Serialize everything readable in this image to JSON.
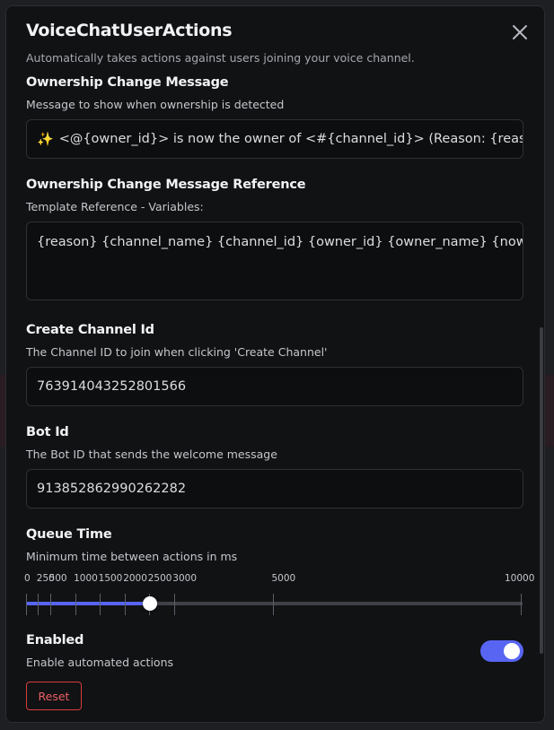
{
  "modal": {
    "title": "VoiceChatUserActions",
    "subtitle": "Automatically takes actions against users joining your voice channel."
  },
  "icons": {
    "close": "close-icon",
    "sparkle": "sparkles-icon"
  },
  "fields": {
    "ownership_message": {
      "label": "Ownership Change Message",
      "description": "Message to show when ownership is detected",
      "emoji": "✨",
      "value": "<@{owner_id}> is now the owner of <#{channel_id}> (Reason: {reason})"
    },
    "ownership_reference": {
      "label": "Ownership Change Message Reference",
      "description": "Template Reference - Variables:",
      "value": "{reason} {channel_name} {channel_id} {owner_id} {owner_name} {now}"
    },
    "create_channel_id": {
      "label": "Create Channel Id",
      "description": "The Channel ID to join when clicking 'Create Channel'",
      "value": "763914043252801566"
    },
    "bot_id": {
      "label": "Bot Id",
      "description": "The Bot ID that sends the welcome message",
      "value": "913852862990262282"
    },
    "queue_time": {
      "label": "Queue Time",
      "description": "Minimum time between actions in ms",
      "markers": [
        "0",
        "250",
        "500",
        "1000",
        "1500",
        "2000",
        "2500",
        "3000",
        "5000",
        "10000"
      ],
      "value": 2500
    },
    "enabled": {
      "label": "Enabled",
      "description": "Enable automated actions",
      "value": true
    }
  },
  "buttons": {
    "reset": "Reset"
  },
  "colors": {
    "accent": "#5865f2",
    "danger": "#d83c3e",
    "background": "#111214"
  }
}
